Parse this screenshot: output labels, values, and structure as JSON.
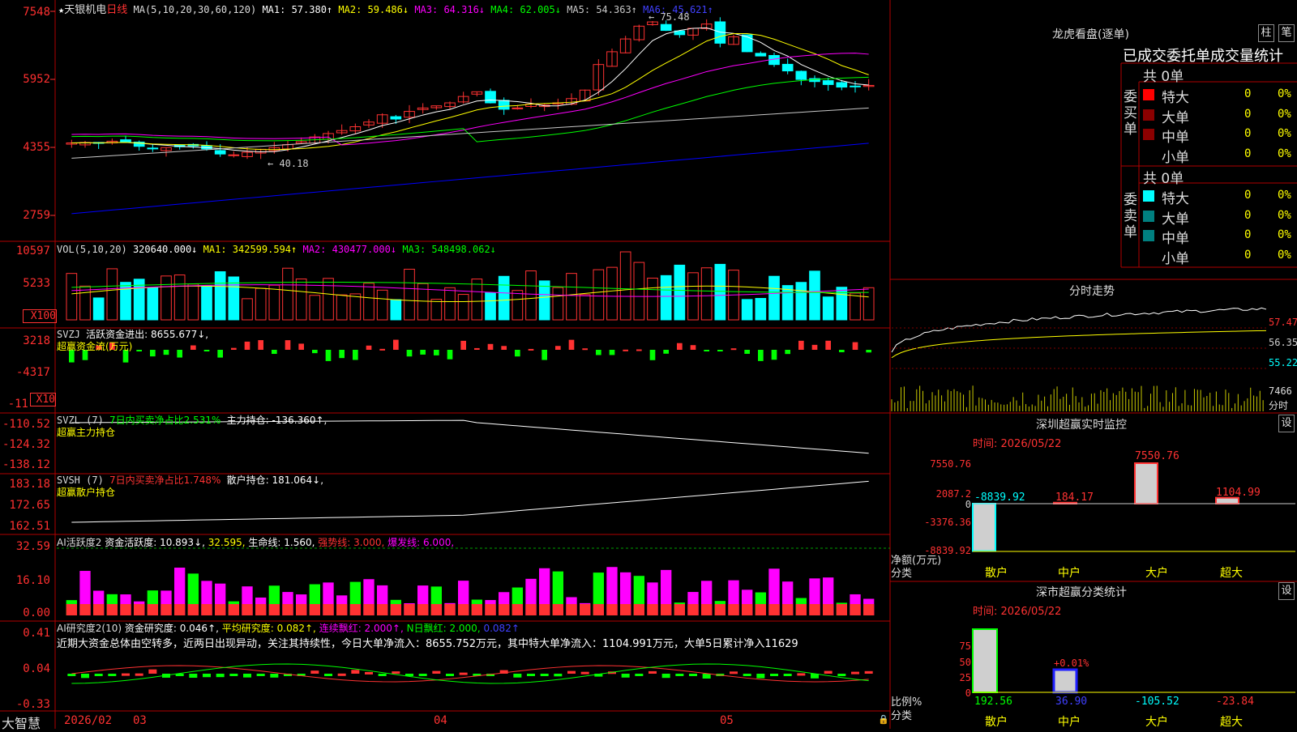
{
  "stock": {
    "name": "天银机电",
    "period": "日线",
    "star": "★"
  },
  "colors": {
    "up": "#ff3232",
    "down": "#00ffff",
    "ma1": "#ffffff",
    "ma2": "#ffff00",
    "ma3": "#ff00ff",
    "ma4": "#00ff00",
    "ma5": "#c8c8c8",
    "ma6": "#0000ff",
    "green": "#00ff00"
  },
  "main_header": {
    "ma_label": "MA(5,10,20,30,60,120)",
    "ma1": "MA1: 57.380↑",
    "ma2": "MA2: 59.486↓",
    "ma3": "MA3: 64.316↓",
    "ma4": "MA4: 62.005↓",
    "ma5": "MA5: 54.363↑",
    "ma6": "MA6: 45.621↑"
  },
  "main_axis": [
    "7548",
    "5952",
    "4355",
    "2759"
  ],
  "annotations": {
    "high": "75.48",
    "low": "40.18"
  },
  "vol_header": {
    "label": "VOL(5,10,20)",
    "v": "320640.000↓",
    "ma1": "MA1: 342599.594↑",
    "ma2": "MA2: 430477.000↓",
    "ma3": "MA3: 548498.062↓"
  },
  "vol_axis": [
    "10597",
    "5233",
    "X100"
  ],
  "svzj_header": {
    "label": "SVZJ",
    "text": "活跃资金进出: 8655.677↓,",
    "line2": "超赢资金流(万元)"
  },
  "svzj_axis": [
    "3218",
    "-4317",
    "-11",
    "X10"
  ],
  "svzl_header": {
    "label": "SVZL (7)",
    "pct": "7日内买卖净占比2.531%",
    "text": "主力持仓: -136.360↑,",
    "line2": "超赢主力持仓"
  },
  "svzl_axis": [
    "-110.52",
    "-124.32",
    "-138.12"
  ],
  "svsh_header": {
    "label": "SVSH (7)",
    "pct": "7日内买卖净占比1.748%",
    "text": "散户持仓: 181.064↓,",
    "line2": "超赢散户持仓"
  },
  "svsh_axis": [
    "183.18",
    "172.65",
    "162.51"
  ],
  "ai1_header": {
    "label": "AI活跃度2",
    "a": "资金活跃度: 10.893↓,",
    "b": "32.595,",
    "c": "生命线: 1.560,",
    "d": "强势线: 3.000,",
    "e": "爆发线: 6.000,"
  },
  "ai1_axis": [
    "32.59",
    "16.10",
    "0.00"
  ],
  "ai2_header": {
    "label": "AI研究度2(10)",
    "a": "资金研究度: 0.046↑,",
    "b": "平均研究度: 0.082↑,",
    "c": "连续飘红: 2.000↑,",
    "d": "N日飘红: 2.000,",
    "e": "0.082↑"
  },
  "ai2_text": "近期大资金总体由空转多，近两日出现异动，关注其持续性，今日大单净流入：8655.752万元，其中特大单净流入：1104.991万元，大单5日累计净入11629",
  "ai2_axis": [
    "0.41",
    "0.04",
    "-0.33"
  ],
  "bottom": {
    "brand": "大智慧",
    "dates": [
      "2026/02",
      "03",
      "04",
      "05"
    ]
  },
  "lhb": {
    "title": "龙虎看盘(逐单)",
    "btn1": "柱",
    "btn2": "笔",
    "tabs": "已成交委托单成交量统计",
    "buy_label": "委买单",
    "sell_label": "委卖单",
    "buy_total": "共 0单",
    "sell_total": "共 0单",
    "rows": [
      {
        "name": "特大",
        "count": "0",
        "pct": "0%"
      },
      {
        "name": "大单",
        "count": "0",
        "pct": "0%"
      },
      {
        "name": "中单",
        "count": "0",
        "pct": "0%"
      },
      {
        "name": "小单",
        "count": "0",
        "pct": "0%"
      }
    ]
  },
  "fenshi": {
    "title": "分时走势",
    "p1": "57.47",
    "p2": "56.35",
    "p3": "55.22",
    "v": "7466",
    "unit": "分时"
  },
  "sz_monitor": {
    "title": "深圳超赢实时监控",
    "btn": "设",
    "time": "时间: 2026/05/22",
    "axis": [
      "7550.76",
      "2087.2",
      "0",
      "-3376.36",
      "-8839.92"
    ],
    "ylabel": "净额(万元)",
    "xlabel": "分类",
    "categories": [
      "散户",
      "中户",
      "大户",
      "超大"
    ],
    "values": [
      -8839.92,
      184.17,
      7550.76,
      1104.99
    ],
    "value_labels": [
      "-8839.92",
      "184.17",
      "7550.76",
      "1104.99"
    ]
  },
  "sz_stats": {
    "title": "深市超赢分类统计",
    "btn": "设",
    "time": "时间: 2026/05/22",
    "axis": [
      "75",
      "50",
      "25",
      "0"
    ],
    "ylabel": "比例%",
    "xlabel": "分类",
    "categories": [
      "散户",
      "中户",
      "大户",
      "超大"
    ],
    "values": [
      192.56,
      36.9,
      -105.52,
      -23.84
    ],
    "value_labels": [
      "192.56",
      "36.90",
      "-105.52",
      "-23.84"
    ],
    "note": "+0.01%"
  }
}
